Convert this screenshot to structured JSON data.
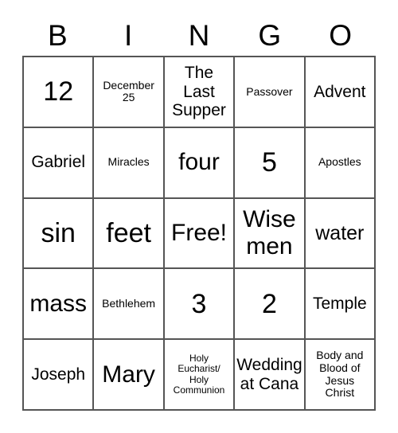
{
  "card": {
    "title": "BINGO",
    "header_letters": [
      "B",
      "I",
      "N",
      "G",
      "O"
    ],
    "columns": 5,
    "rows": 5,
    "border_color": "#555555",
    "text_color": "#000000",
    "background_color": "#ffffff",
    "free_space_label": "Free!",
    "cells": [
      [
        {
          "text": "12",
          "size": "fs-xxl"
        },
        {
          "text": "December\n25",
          "size": "fs-sm"
        },
        {
          "text": "The\nLast\nSupper",
          "size": "fs-md"
        },
        {
          "text": "Passover",
          "size": "fs-sm"
        },
        {
          "text": "Advent",
          "size": "fs-md"
        }
      ],
      [
        {
          "text": "Gabriel",
          "size": "fs-md"
        },
        {
          "text": "Miracles",
          "size": "fs-sm"
        },
        {
          "text": "four",
          "size": "fs-xl"
        },
        {
          "text": "5",
          "size": "fs-xxl"
        },
        {
          "text": "Apostles",
          "size": "fs-sm"
        }
      ],
      [
        {
          "text": "sin",
          "size": "fs-xxl"
        },
        {
          "text": "feet",
          "size": "fs-xxl"
        },
        {
          "text": "Free!",
          "size": "fs-xl"
        },
        {
          "text": "Wise\nmen",
          "size": "fs-xl"
        },
        {
          "text": "water",
          "size": "fs-lg"
        }
      ],
      [
        {
          "text": "mass",
          "size": "fs-xl"
        },
        {
          "text": "Bethlehem",
          "size": "fs-sm"
        },
        {
          "text": "3",
          "size": "fs-xxl"
        },
        {
          "text": "2",
          "size": "fs-xxl"
        },
        {
          "text": "Temple",
          "size": "fs-md"
        }
      ],
      [
        {
          "text": "Joseph",
          "size": "fs-md"
        },
        {
          "text": "Mary",
          "size": "fs-xl"
        },
        {
          "text": "Holy\nEucharist/\nHoly\nCommunion",
          "size": "fs-xs"
        },
        {
          "text": "Wedding\nat Cana",
          "size": "fs-md"
        },
        {
          "text": "Body and\nBlood of\nJesus\nChrist",
          "size": "fs-sm"
        }
      ]
    ]
  }
}
